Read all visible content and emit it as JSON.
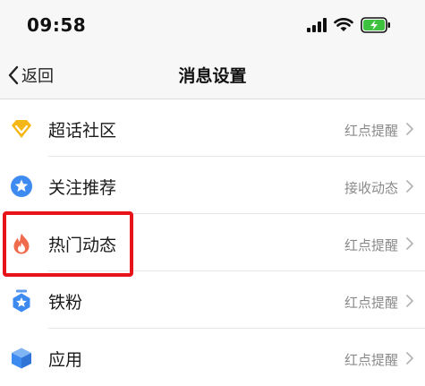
{
  "status_bar": {
    "time": "09:58"
  },
  "nav": {
    "back_label": "返回",
    "title": "消息设置"
  },
  "items": [
    {
      "label": "超话社区",
      "value": "红点提醒",
      "icon": "diamond-icon"
    },
    {
      "label": "关注推荐",
      "value": "接收动态",
      "icon": "star-icon"
    },
    {
      "label": "热门动态",
      "value": "红点提醒",
      "icon": "flame-icon"
    },
    {
      "label": "铁粉",
      "value": "红点提醒",
      "icon": "badge-icon"
    },
    {
      "label": "应用",
      "value": "红点提醒",
      "icon": "cube-icon"
    }
  ],
  "colors": {
    "accent_blue": "#3d8bf0",
    "highlight_red": "#e8141b",
    "flame": "#f06a4d",
    "diamond": "#f5b718"
  }
}
